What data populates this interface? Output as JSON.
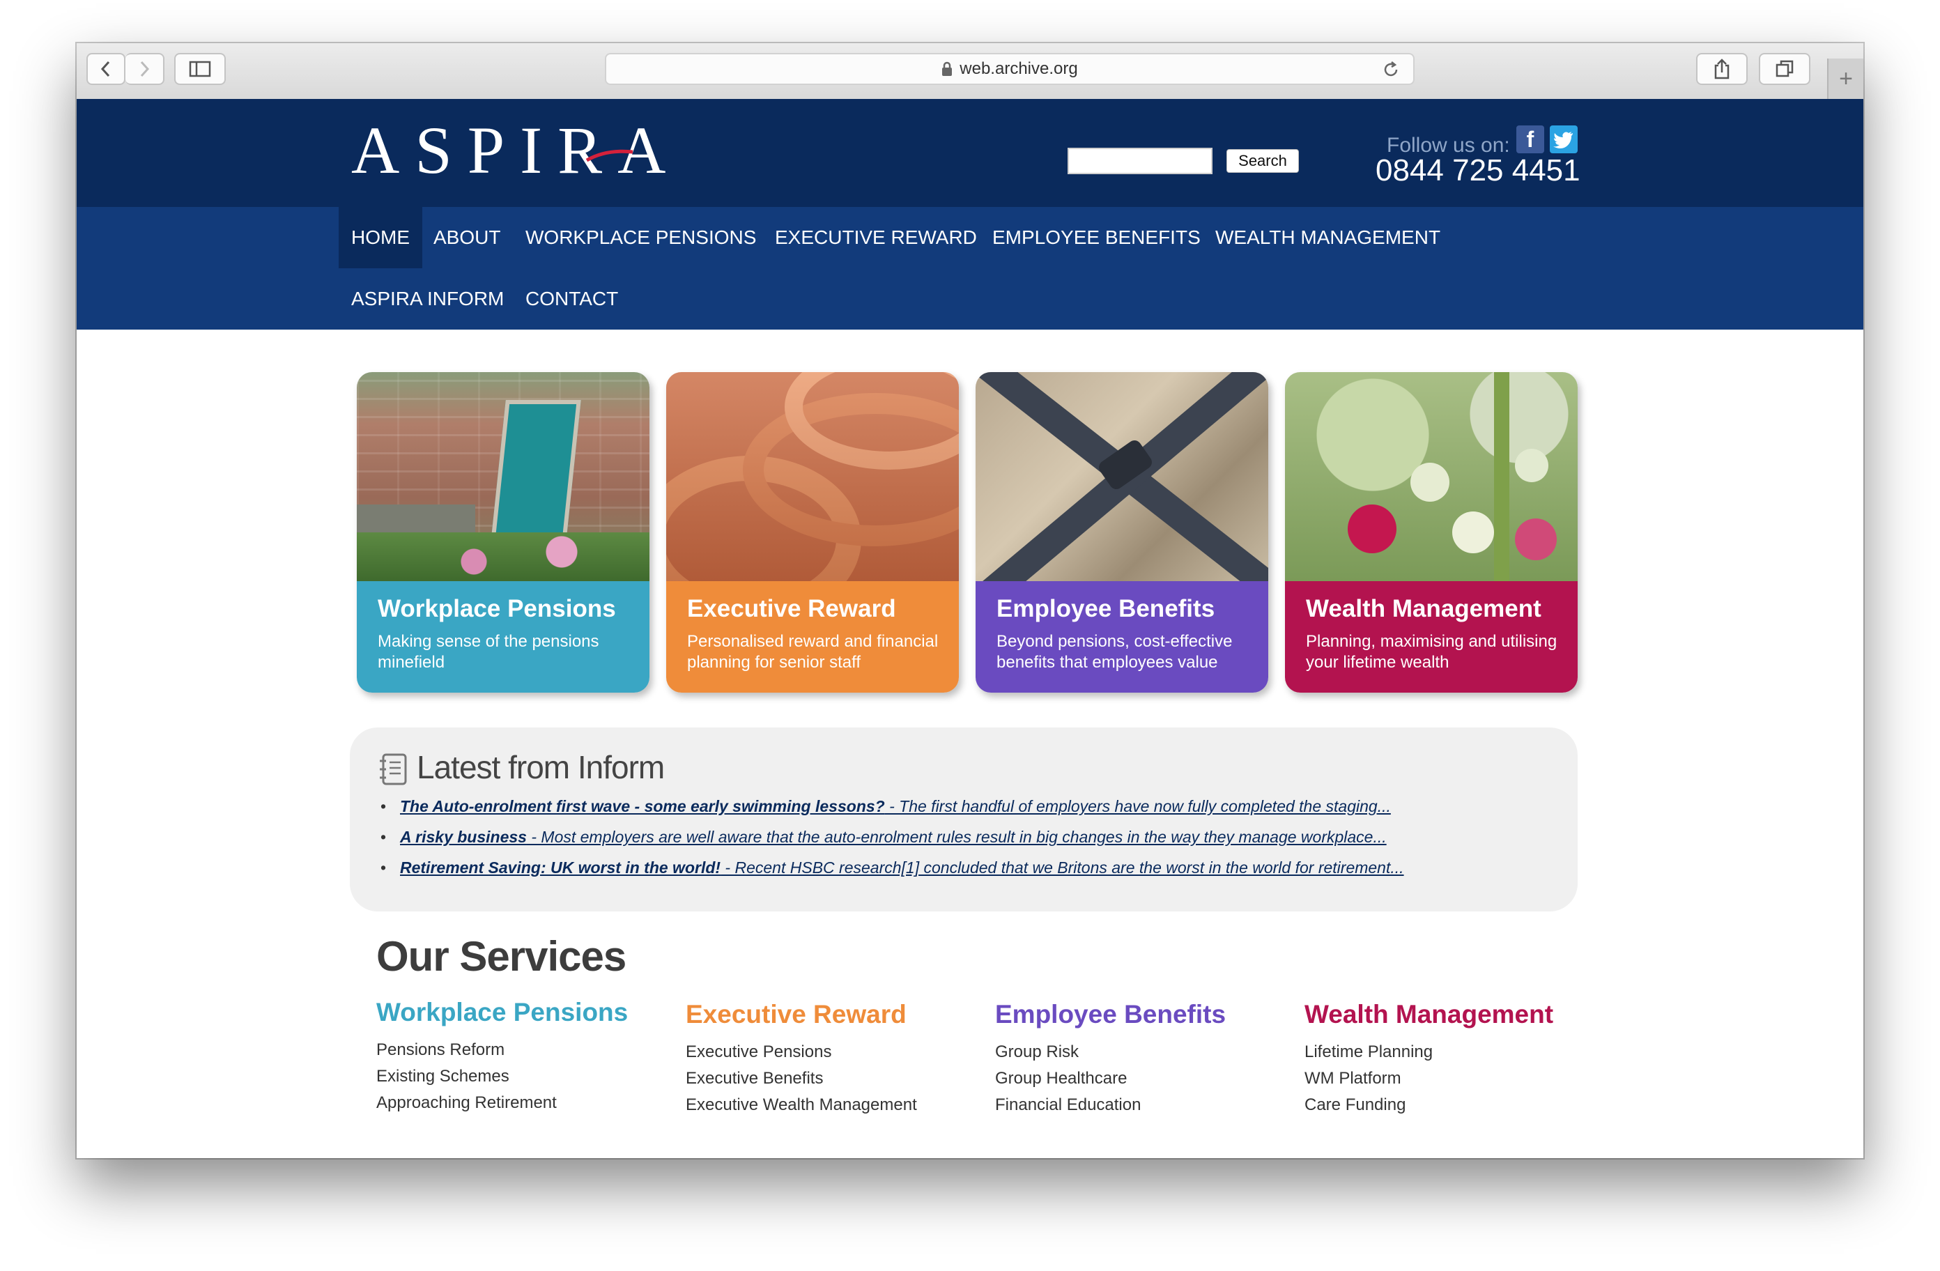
{
  "browser": {
    "url": "web.archive.org"
  },
  "header": {
    "logo_text": "ASPIRA",
    "search_button": "Search",
    "search_placeholder": "",
    "follow_label": "Follow us on:",
    "phone": "0844 725 4451"
  },
  "nav": {
    "items": [
      {
        "label": "HOME",
        "active": true
      },
      {
        "label": "ABOUT"
      },
      {
        "label": "WORKPLACE PENSIONS"
      },
      {
        "label": "EXECUTIVE REWARD"
      },
      {
        "label": "EMPLOYEE BENEFITS"
      },
      {
        "label": "WEALTH MANAGEMENT"
      },
      {
        "label": "ASPIRA INFORM"
      },
      {
        "label": "CONTACT"
      }
    ]
  },
  "tiles": [
    {
      "title": "Workplace Pensions",
      "subtitle": "Making sense of the pensions minefield",
      "color": "#3aa6c4"
    },
    {
      "title": "Executive Reward",
      "subtitle": "Personalised reward and financial planning for senior staff",
      "color": "#ef8c3a"
    },
    {
      "title": "Employee Benefits",
      "subtitle": "Beyond pensions, cost-effective benefits that employees value",
      "color": "#6a4bc0"
    },
    {
      "title": "Wealth Management",
      "subtitle": "Planning, maximising and utilising your lifetime wealth",
      "color": "#b3134f"
    }
  ],
  "inform": {
    "title": "Latest from Inform",
    "articles": [
      {
        "headline": "The Auto-enrolment first wave - some early swimming lessons?",
        "excerpt": " - The first handful of employers have now fully completed the staging..."
      },
      {
        "headline": "A risky business",
        "excerpt": " - Most employers are well aware that the auto-enrolment rules result in big changes in the way they manage workplace..."
      },
      {
        "headline": "Retirement Saving: UK worst in the world!",
        "excerpt": " - Recent HSBC research[1] concluded that we Britons are the worst in the world for retirement..."
      }
    ]
  },
  "services": {
    "title": "Our Services",
    "columns": [
      {
        "heading": "Workplace Pensions",
        "color": "#3aa6c4",
        "items": [
          "Pensions Reform",
          "Existing Schemes",
          "Approaching Retirement"
        ]
      },
      {
        "heading": "Executive Reward",
        "color": "#ef8c3a",
        "items": [
          "Executive Pensions",
          "Executive Benefits",
          "Executive Wealth Management"
        ]
      },
      {
        "heading": "Employee Benefits",
        "color": "#6a4bc0",
        "items": [
          "Group Risk",
          "Group Healthcare",
          "Financial Education"
        ]
      },
      {
        "heading": "Wealth Management",
        "color": "#b3134f",
        "items": [
          "Lifetime Planning",
          "WM Platform",
          "Care Funding"
        ]
      }
    ]
  },
  "icons": [
    "back-arrow-icon",
    "forward-arrow-icon",
    "sidebar-icon",
    "lock-icon",
    "reload-icon",
    "share-icon",
    "tabs-icon",
    "new-tab-plus-icon",
    "facebook-icon",
    "twitter-icon",
    "notebook-icon"
  ]
}
